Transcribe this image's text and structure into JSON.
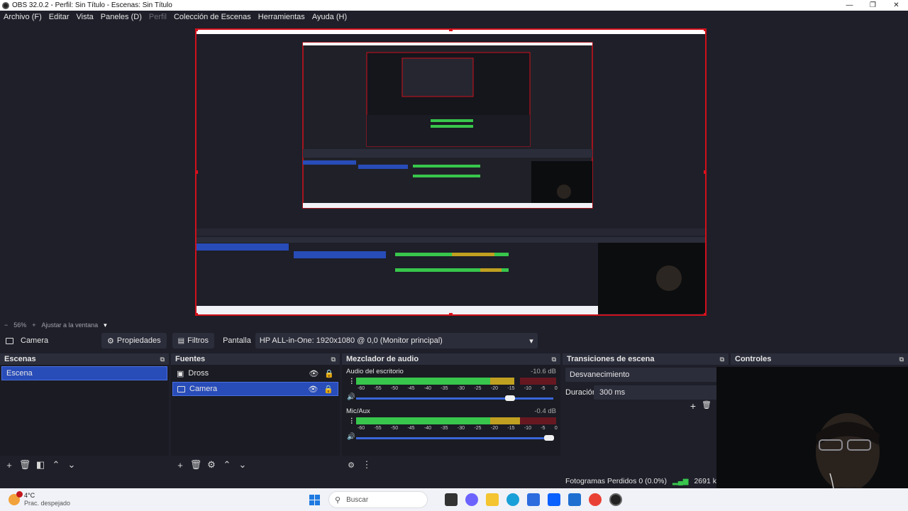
{
  "window": {
    "title": "OBS 32.0.2 - Perfil: Sin Título - Escenas: Sin Título",
    "min": "—",
    "max": "❐",
    "close": "✕"
  },
  "menu": [
    "Archivo (F)",
    "Editar",
    "Vista",
    "Paneles (D)",
    "Perfil",
    "Colección de Escenas",
    "Herramientas",
    "Ayuda (H)"
  ],
  "zoom": {
    "minus": "−",
    "value": "56%",
    "plus": "+",
    "fit": "Ajustar a la ventana",
    "dropdown": "▾"
  },
  "source_bar": {
    "source_name": "Camera",
    "properties": "Propiedades",
    "filters": "Filtros",
    "display_label": "Pantalla",
    "display_value": "HP ALL-in-One: 1920x1080 @ 0,0 (Monitor principal)"
  },
  "scenes": {
    "title": "Escenas",
    "items": [
      {
        "label": "Escena",
        "selected": true
      }
    ]
  },
  "sources": {
    "title": "Fuentes",
    "items": [
      {
        "label": "Dross",
        "selected": false
      },
      {
        "label": "Camera",
        "selected": true
      }
    ]
  },
  "mixer": {
    "title": "Mezclador de audio",
    "channels": [
      {
        "name": "Audio del escritorio",
        "db": "-10.6 dB",
        "level": 0.79,
        "volume": 0.78
      },
      {
        "name": "Mic/Aux",
        "db": "-0.4 dB",
        "level": 0.89,
        "volume": 0.98
      }
    ],
    "ticks": [
      "-60",
      "-55",
      "-50",
      "-45",
      "-40",
      "-35",
      "-30",
      "-25",
      "-20",
      "-15",
      "-10",
      "-5",
      "0"
    ]
  },
  "transitions": {
    "title": "Transiciones de escena",
    "type": "Desvanecimiento",
    "duration_label": "Duración",
    "duration_value": "300 ms"
  },
  "controls": {
    "title": "Controles"
  },
  "status": {
    "dropped": "Fotogramas Perdidos 0 (0.0%)",
    "bitrate": "2691 k"
  },
  "taskbar": {
    "weather_temp": "4°C",
    "weather_desc": "Prac. despejado",
    "search_placeholder": "Buscar"
  },
  "colors": {
    "accent": "#284cb8",
    "selection_border": "#d0101b",
    "bg": "#1e1f29"
  }
}
